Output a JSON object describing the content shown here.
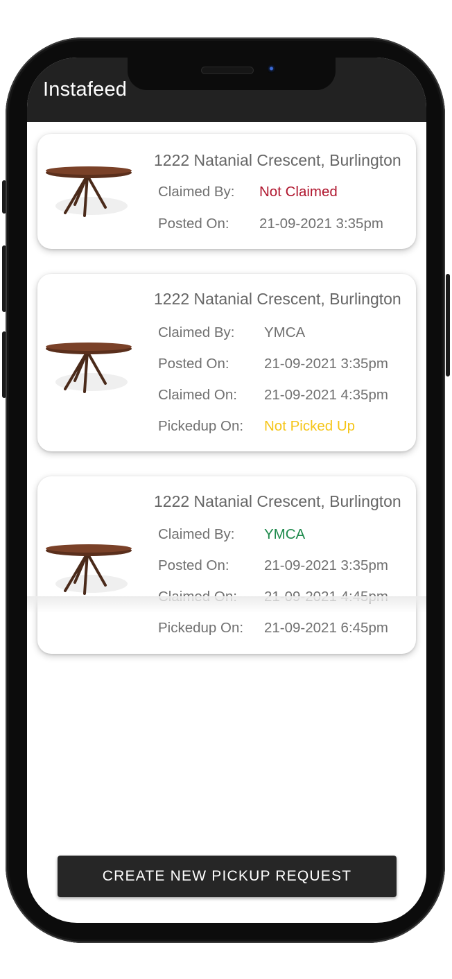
{
  "app": {
    "title": "Instafeed"
  },
  "colors": {
    "app_bar": "#222222",
    "not_claimed": "#b0172f",
    "not_picked_up": "#f5c518",
    "claimed": "#1e8a4c",
    "button": "#262626"
  },
  "feed": [
    {
      "address": "1222 Natanial Crescent, Burlington",
      "image_icon": "table-photo",
      "fields": [
        {
          "label": "Claimed By:",
          "value": "Not Claimed"
        },
        {
          "label": "Posted On:",
          "value": "21-09-2021 3:35pm"
        }
      ]
    },
    {
      "address": "1222 Natanial Crescent, Burlington",
      "image_icon": "table-photo",
      "fields": [
        {
          "label": "Claimed By:",
          "value": "YMCA"
        },
        {
          "label": "Posted On:",
          "value": "21-09-2021 3:35pm"
        },
        {
          "label": "Claimed On:",
          "value": "21-09-2021 4:35pm"
        },
        {
          "label": "Pickedup On:",
          "value": "Not Picked Up"
        }
      ]
    },
    {
      "address": "1222 Natanial Crescent, Burlington",
      "image_icon": "table-photo",
      "fields": [
        {
          "label": "Claimed By:",
          "value": "YMCA"
        },
        {
          "label": "Posted On:",
          "value": "21-09-2021 3:35pm"
        },
        {
          "label": "Claimed On:",
          "value": "21-09-2021 4:45pm"
        },
        {
          "label": "Pickedup On:",
          "value": "21-09-2021 6:45pm"
        }
      ]
    }
  ],
  "actions": {
    "create_label": "CREATE NEW PICKUP REQUEST"
  }
}
